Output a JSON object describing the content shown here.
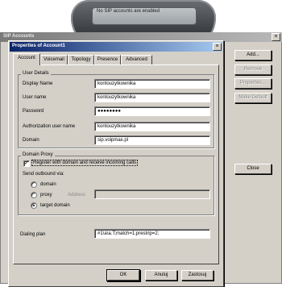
{
  "phone": {
    "notice": "No SIP accounts are enabled"
  },
  "sip_accounts_window": {
    "title": "SIP Accounts",
    "close_glyph": "×",
    "buttons": {
      "add": "Add...",
      "remove": "Remove",
      "properties": "Properties...",
      "make_default": "Make Default",
      "close": "Close"
    }
  },
  "dialog": {
    "title": "Properties of Account1",
    "close_glyph": "×",
    "tabs": [
      "Account",
      "Voicemail",
      "Topology",
      "Presence",
      "Advanced"
    ],
    "user_details": {
      "group_label": "User Details",
      "display_name_label": "Display Name",
      "display_name_value": "kontouzytkownika",
      "user_name_label": "User name",
      "user_name_value": "kontouzytkownika",
      "password_label": "Password",
      "password_value": "●●●●●●●●",
      "auth_user_label": "Authorization user name",
      "auth_user_value": "kontouzytkownika",
      "domain_label": "Domain",
      "domain_value": "sip.voipmax.pl"
    },
    "domain_proxy": {
      "group_label": "Domain Proxy",
      "register_checkbox_label": "Register with domain and receive incoming calls",
      "register_checked_glyph": "✓",
      "send_outbound_label": "Send outbound via:",
      "option_domain": "domain",
      "option_proxy": "proxy",
      "address_label": "Address",
      "address_value": "",
      "option_target_domain": "target domain",
      "selected": "target domain"
    },
    "dialing_plan_label": "Dialing plan",
    "dialing_plan_value": "#1\\a\\a.T;match=1;prestrip=2;",
    "buttons": {
      "ok": "OK",
      "cancel": "Anuluj",
      "apply": "Zastosuj"
    }
  }
}
